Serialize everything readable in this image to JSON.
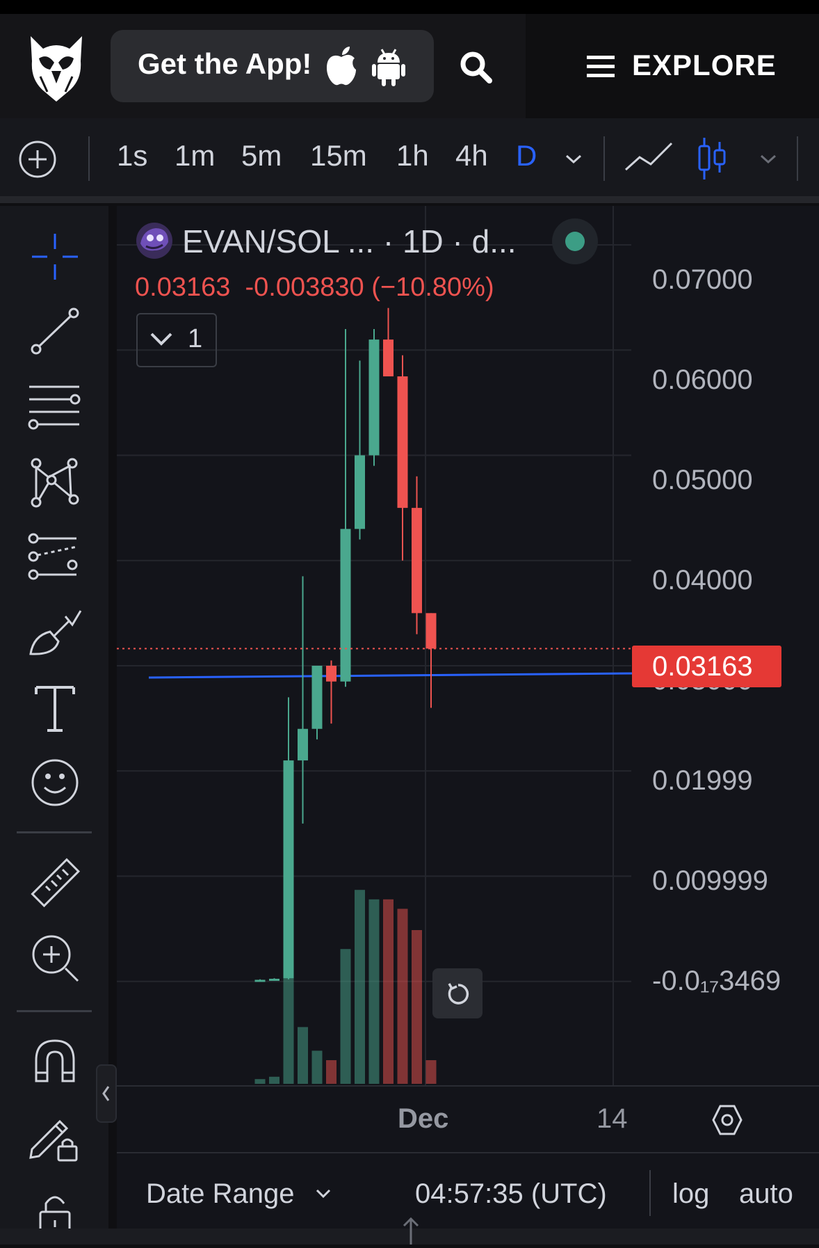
{
  "header": {
    "app_cta": "Get the App!",
    "explore_label": "EXPLORE",
    "icons": [
      "owl-logo-icon",
      "apple-icon",
      "android-icon",
      "search-icon",
      "menu-icon"
    ]
  },
  "toolbar": {
    "timeframes": [
      "1s",
      "1m",
      "5m",
      "15m",
      "1h",
      "4h",
      "D"
    ],
    "active_timeframe": "D",
    "accent_color": "#2962ff"
  },
  "chart": {
    "symbol_title": "EVAN/SOL ... · 1D · d...",
    "last_price": "0.03163",
    "change": "-0.003830",
    "change_pct": "(−10.80%)",
    "collapse_count": "1",
    "y_labels": [
      "0.07000",
      "0.06000",
      "0.05000",
      "0.04000",
      "0.03000",
      "0.01999",
      "0.009999",
      "-0.0₁₇3469"
    ],
    "price_tag": "0.03163",
    "x_labels": [
      "Dec",
      "14"
    ],
    "up_color": "#4aa88e",
    "down_color": "#ef5350"
  },
  "chart_data": {
    "type": "candlestick",
    "y_range": [
      -0.01,
      0.0737
    ],
    "candles": [
      {
        "o": 0.0001,
        "h": 0.0002,
        "l": 0.0,
        "c": 0.00015
      },
      {
        "o": 0.0002,
        "h": 0.0003,
        "l": 0.0001,
        "c": 0.00025
      },
      {
        "o": 0.0003,
        "h": 0.027,
        "l": 0.0002,
        "c": 0.021
      },
      {
        "o": 0.021,
        "h": 0.0385,
        "l": 0.015,
        "c": 0.024
      },
      {
        "o": 0.024,
        "h": 0.03,
        "l": 0.023,
        "c": 0.03
      },
      {
        "o": 0.03,
        "h": 0.0305,
        "l": 0.0245,
        "c": 0.0285
      },
      {
        "o": 0.0285,
        "h": 0.062,
        "l": 0.028,
        "c": 0.043
      },
      {
        "o": 0.043,
        "h": 0.059,
        "l": 0.042,
        "c": 0.05
      },
      {
        "o": 0.05,
        "h": 0.062,
        "l": 0.049,
        "c": 0.061
      },
      {
        "o": 0.061,
        "h": 0.064,
        "l": 0.059,
        "c": 0.0575
      },
      {
        "o": 0.0575,
        "h": 0.0595,
        "l": 0.04,
        "c": 0.045
      },
      {
        "o": 0.045,
        "h": 0.048,
        "l": 0.033,
        "c": 0.035
      },
      {
        "o": 0.035,
        "h": 0.035,
        "l": 0.026,
        "c": 0.03163
      }
    ],
    "volume_ratio": [
      0.02,
      0.03,
      0.55,
      0.24,
      0.14,
      0.1,
      0.57,
      0.82,
      0.78,
      0.78,
      0.74,
      0.65,
      0.1
    ]
  },
  "bottom": {
    "date_range": "Date Range",
    "time": "04:57:35 (UTC)",
    "log": "log",
    "auto": "auto"
  }
}
